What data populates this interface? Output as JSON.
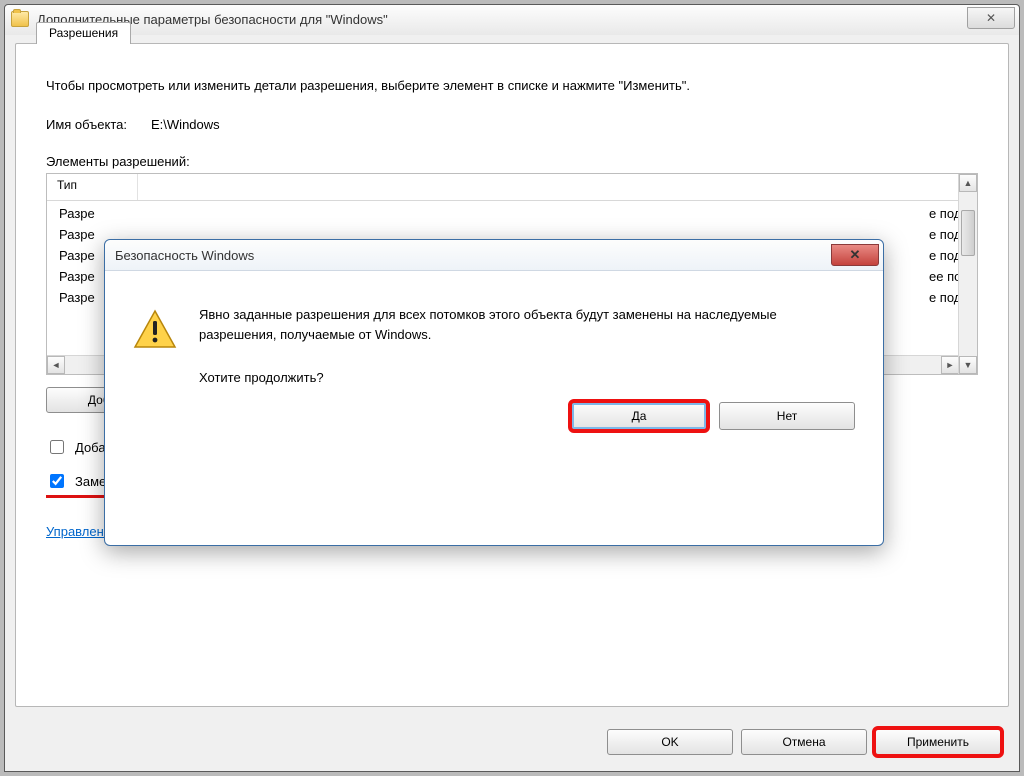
{
  "main": {
    "title": "Дополнительные параметры безопасности  для \"Windows\"",
    "close_glyph": "✕",
    "tab_label": "Разрешения",
    "intro": "Чтобы просмотреть или изменить детали разрешения, выберите элемент в списке и нажмите \"Изменить\".",
    "object_label": "Имя объекта:",
    "object_value": "E:\\Windows",
    "list_label": "Элементы разрешений:",
    "col_type": "Тип",
    "rows": {
      "r0a": "Разре",
      "r1a": "Разре",
      "r2a": "Разре",
      "r3a": "Разре",
      "r4a": "Разре",
      "r0b": "е под.",
      "r1b": "е под.",
      "r2b": "е под.",
      "r3b": "ее по.",
      "r4b": "е под."
    },
    "add_btn": "Доба",
    "chk1_label": "Добавить разрешения, наследуемые от родительских объектов",
    "chk2_label": "Заменить все разрешения дочернего объекта на разрешения, наследуемые от этого объекта",
    "link": "Управление разрешениями",
    "ok": "OK",
    "cancel": "Отмена",
    "apply": "Применить"
  },
  "modal": {
    "title": "Безопасность Windows",
    "line1": "Явно заданные разрешения для всех потомков этого объекта будут заменены на наследуемые разрешения, получаемые от Windows.",
    "question": "Хотите продолжить?",
    "yes": "Да",
    "no": "Нет"
  }
}
